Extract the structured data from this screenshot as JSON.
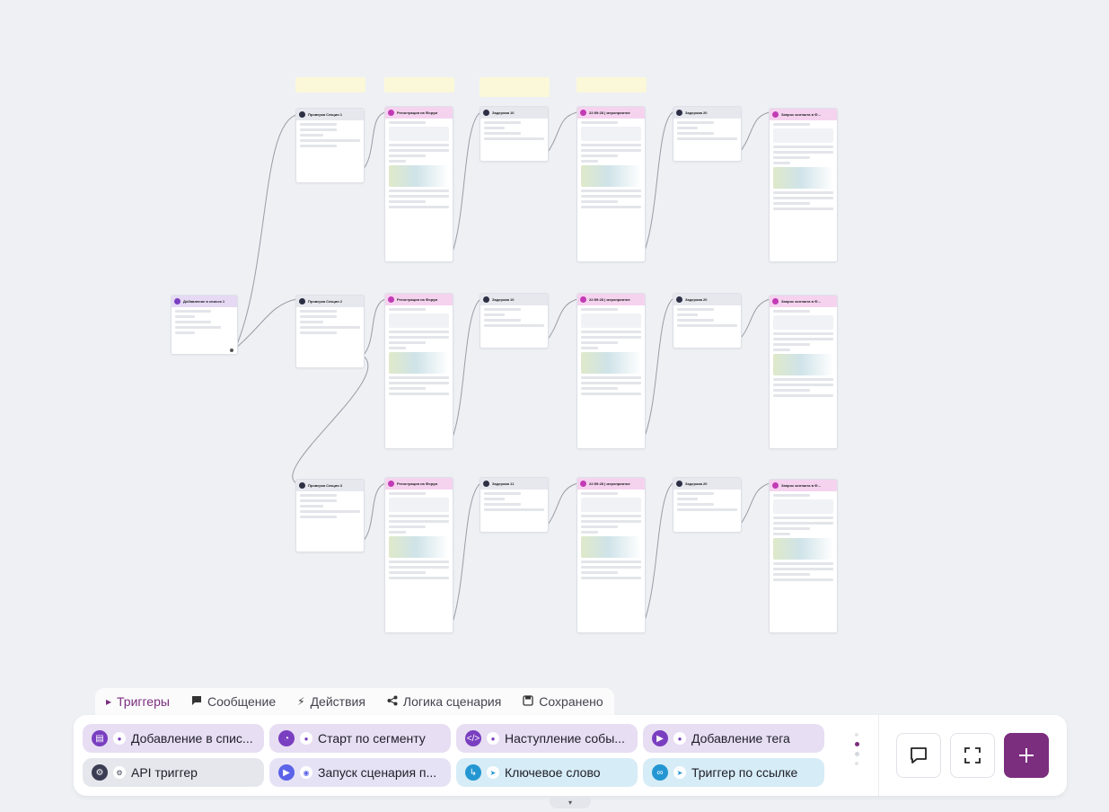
{
  "tabs": [
    {
      "label": "Триггеры",
      "icon": "play-icon",
      "active": true
    },
    {
      "label": "Сообщение",
      "icon": "chat-icon"
    },
    {
      "label": "Действия",
      "icon": "bolt-icon"
    },
    {
      "label": "Логика сценария",
      "icon": "share-icon"
    },
    {
      "label": "Сохранено",
      "icon": "save-icon"
    }
  ],
  "triggers": [
    {
      "label": "Добавление в спис...",
      "icon": "list-icon",
      "sub_icon": "user-icon",
      "color": "purple"
    },
    {
      "label": "Старт по сегменту",
      "icon": "pie-icon",
      "sub_icon": "user-icon",
      "color": "purple"
    },
    {
      "label": "Наступление собы...",
      "icon": "code-icon",
      "sub_icon": "user-icon",
      "color": "purple"
    },
    {
      "label": "Добавление тега",
      "icon": "tag-icon",
      "sub_icon": "user-icon",
      "color": "purple"
    },
    {
      "label": "API триггер",
      "icon": "gear-icon",
      "sub_icon": "gear-small-icon",
      "color": "grey"
    },
    {
      "label": "Запуск сценария п...",
      "icon": "play-icon",
      "sub_icon": "messenger-icon",
      "color": "violet"
    },
    {
      "label": "Ключевое слово",
      "icon": "keyword-icon",
      "sub_icon": "telegram-icon",
      "color": "blue"
    },
    {
      "label": "Триггер по ссылке",
      "icon": "link-icon",
      "sub_icon": "telegram-icon",
      "color": "blue"
    }
  ],
  "canvas": {
    "start_node": {
      "title": "Добавление в список 1"
    },
    "rows": [
      {
        "check": "Проверка Секции 1",
        "msg1": "Регистрация на Форум",
        "delay1": "Задержка 10",
        "msg2": "22:59:28 | мероприятие",
        "delay2": "Задержка 20",
        "msg3": "Запрос контакта в Ф..."
      },
      {
        "check": "Проверка Секции 2",
        "msg1": "Регистрация на Форум",
        "delay1": "Задержка 10",
        "msg2": "22:59:28 | мероприятие",
        "delay2": "Задержка 20",
        "msg3": "Запрос контакта в Ф..."
      },
      {
        "check": "Проверка Секции 3",
        "msg1": "Регистрация на Форум",
        "delay1": "Задержка 11",
        "msg2": "22:59:28 | мероприятие",
        "delay2": "Задержка 20",
        "msg3": "Запрос контакта в Ф..."
      }
    ]
  },
  "colors": {
    "accent": "#7b2d7e",
    "canvas_bg": "#eef0f4"
  }
}
